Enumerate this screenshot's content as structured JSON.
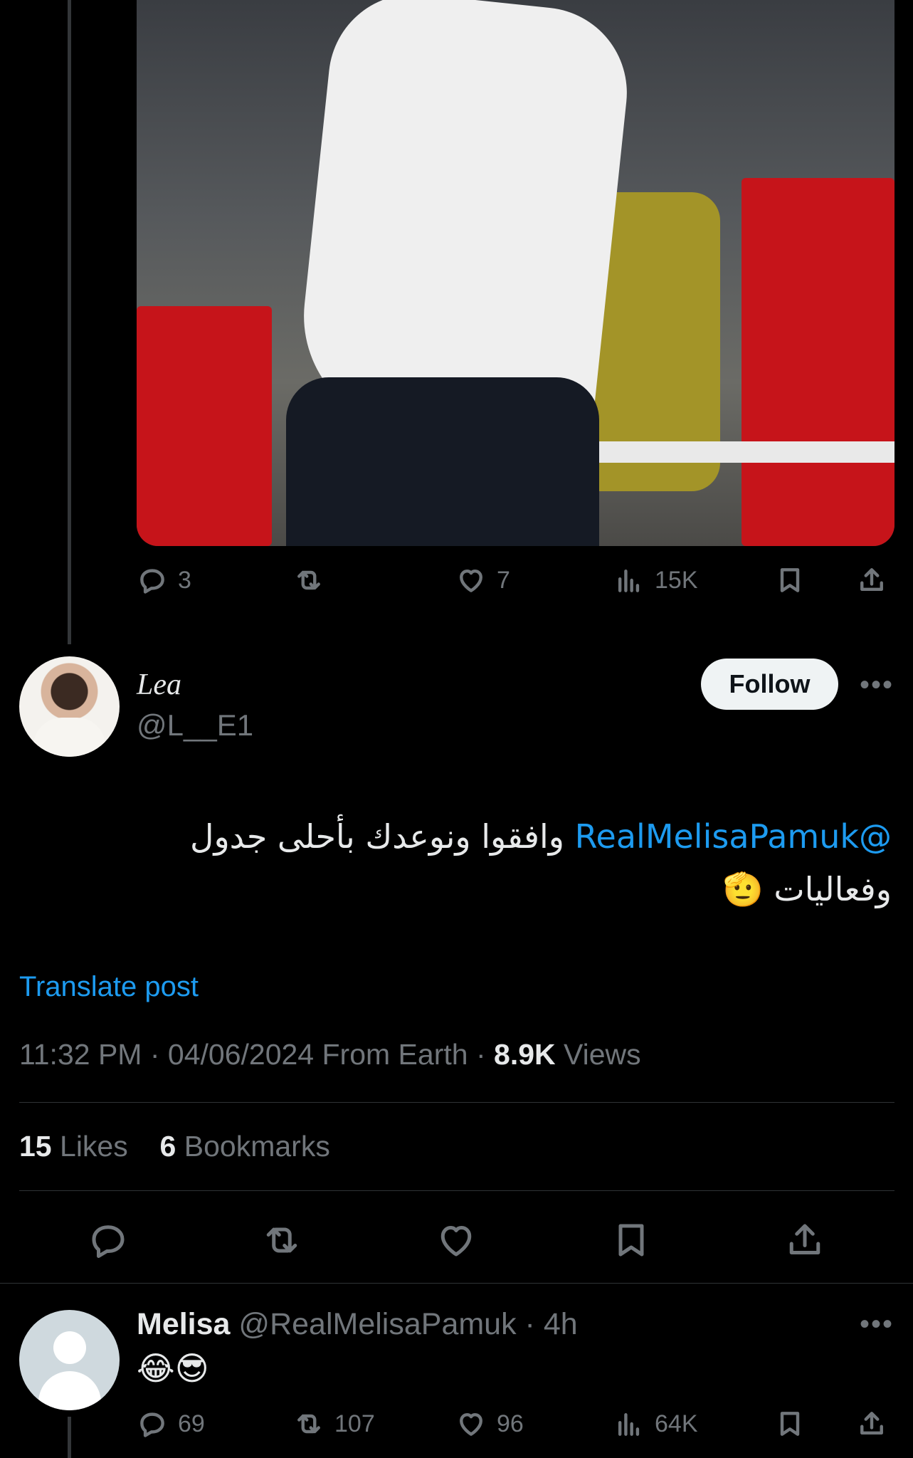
{
  "quoted_post": {
    "actions": {
      "replies": "3",
      "reposts": "",
      "likes": "7",
      "views": "15K"
    }
  },
  "main_post": {
    "author_name": "Lea",
    "author_handle": "@L__E1",
    "follow_label": "Follow",
    "more_label": "•••",
    "text_mention": "@RealMelisaPamuk",
    "text_line1": " وافقوا ونوعدك بأحلى جدول",
    "text_line2": "وفعاليات 🫡",
    "translate_label": "Translate post",
    "time": "11:32 PM",
    "date": "04/06/2024",
    "location": "From Earth",
    "views_count": "8.9K",
    "views_label": "Views",
    "likes_count": "15",
    "likes_label": "Likes",
    "bookmarks_count": "6",
    "bookmarks_label": "Bookmarks"
  },
  "reply": {
    "author_name": "Melisa",
    "author_handle": "@RealMelisaPamuk",
    "time_ago": "4h",
    "more_label": "•••",
    "text": "😂😎",
    "actions": {
      "replies": "69",
      "reposts": "107",
      "likes": "96",
      "views": "64K"
    }
  },
  "icons": [
    "reply-icon",
    "repost-icon",
    "like-icon",
    "views-icon",
    "bookmark-icon",
    "share-icon"
  ],
  "colors": {
    "background": "#000000",
    "text_primary": "#e7e9ea",
    "text_secondary": "#71767b",
    "link": "#1d9bf0",
    "divider": "#2f3336",
    "follow_bg": "#eff3f4"
  }
}
